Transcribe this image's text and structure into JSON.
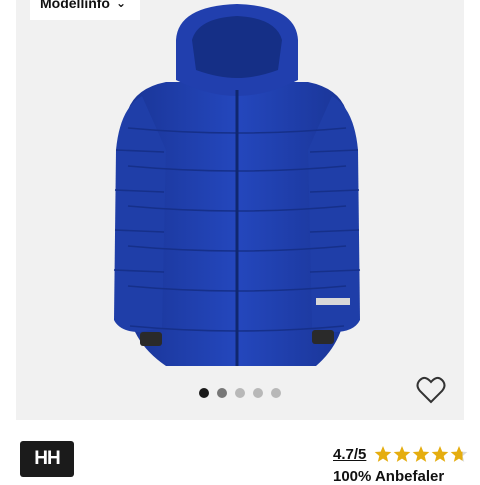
{
  "model_info": {
    "label": "Modellinfo",
    "chevron_icon": "chevron-down-icon"
  },
  "gallery": {
    "image_count": 5,
    "active_index": 0,
    "product_color": "#1d3fa8",
    "favorite_icon": "heart-outline-icon"
  },
  "brand": {
    "logo_text": "HH"
  },
  "rating": {
    "value_text": "4.7/5",
    "value": 4.7,
    "max": 5,
    "star_color": "#e5ad0f",
    "recommend_text": "100% Anbefaler"
  }
}
